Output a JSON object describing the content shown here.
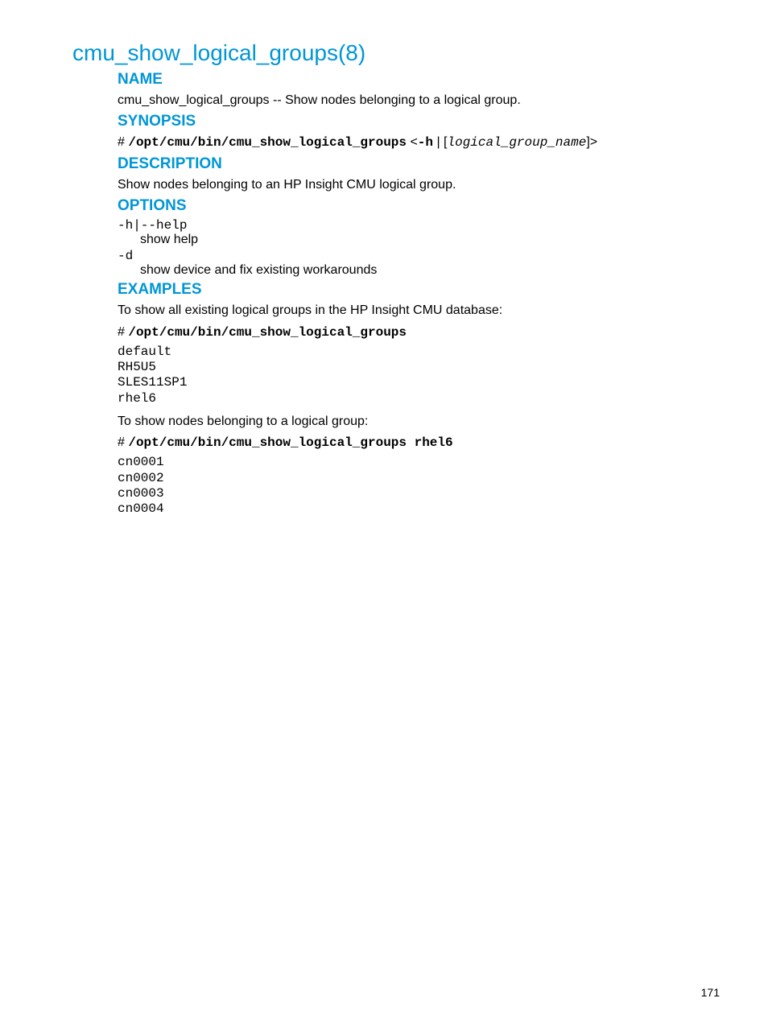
{
  "title": "cmu_show_logical_groups(8)",
  "sections": {
    "name": {
      "heading": "NAME",
      "text": "cmu_show_logical_groups -- Show nodes belonging to a logical group."
    },
    "synopsis": {
      "heading": "SYNOPSIS",
      "prefix": "# ",
      "cmd": "/opt/cmu/bin/cmu_show_logical_groups",
      "args_open": " <",
      "flag": "-h",
      "sep": " | [",
      "varname": "logical_group_name",
      "args_close": "]>"
    },
    "description": {
      "heading": "DESCRIPTION",
      "text": "Show nodes belonging to an HP Insight CMU logical group."
    },
    "options": {
      "heading": "OPTIONS",
      "items": [
        {
          "flag": "-h|--help",
          "desc": "show help"
        },
        {
          "flag": "-d",
          "desc": "show device and fix existing workarounds"
        }
      ]
    },
    "examples": {
      "heading": "EXAMPLES",
      "intro1": "To show all existing logical groups in the HP Insight CMU database:",
      "cmd1_prefix": "# ",
      "cmd1": "/opt/cmu/bin/cmu_show_logical_groups",
      "out1": "default\nRH5U5\nSLES11SP1\nrhel6",
      "intro2": "To show nodes belonging to a logical group:",
      "cmd2_prefix": "# ",
      "cmd2": "/opt/cmu/bin/cmu_show_logical_groups rhel6",
      "out2": "cn0001\ncn0002\ncn0003\ncn0004"
    }
  },
  "page_number": "171"
}
